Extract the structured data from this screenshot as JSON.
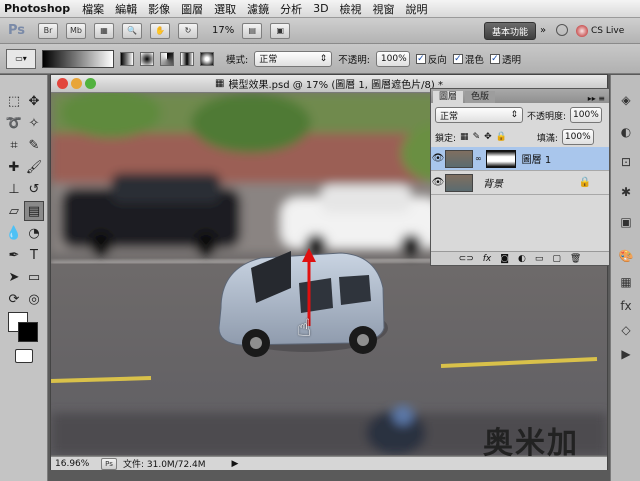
{
  "menubar": {
    "app": "Photoshop",
    "items": [
      "檔案",
      "編輯",
      "影像",
      "圖層",
      "選取",
      "濾鏡",
      "分析",
      "3D",
      "檢視",
      "視窗",
      "說明"
    ]
  },
  "appbar": {
    "ps": "Ps",
    "br": "Br",
    "mb": "Mb",
    "zoom": "17%",
    "workspace": "基本功能",
    "cslive": "CS Live"
  },
  "options": {
    "mode_label": "模式:",
    "mode_value": "正常",
    "opacity_label": "不透明:",
    "opacity_value": "100%",
    "reverse": "反向",
    "dither": "混色",
    "transparency": "透明"
  },
  "document": {
    "title": "模型效果.psd @ 17% (圖層 1, 圖層遮色片/8) *",
    "zoom": "16.96%",
    "file_info": "文件: 31.0M/72.4M"
  },
  "layers_panel": {
    "tab_layers": "圖層",
    "tab_channels": "色版",
    "blend_mode": "正常",
    "opacity_label": "不透明度:",
    "opacity_value": "100%",
    "lock_label": "鎖定:",
    "fill_label": "填滿:",
    "fill_value": "100%",
    "layers": [
      {
        "name": "圖層 1",
        "selected": true
      },
      {
        "name": "背景",
        "selected": false
      }
    ]
  },
  "watermark": "奥米加",
  "icons": [
    "search-icon",
    "eye-icon",
    "lock-icon",
    "link-icon",
    "fx-icon",
    "mask-icon",
    "adjustment-icon",
    "folder-icon",
    "new-layer-icon",
    "trash-icon",
    "hand-cursor-icon",
    "arrow-up-icon"
  ],
  "colors": {
    "selection": "#a9c6ec",
    "arrow": "#e01010",
    "workspace": "#4b4b4b"
  }
}
